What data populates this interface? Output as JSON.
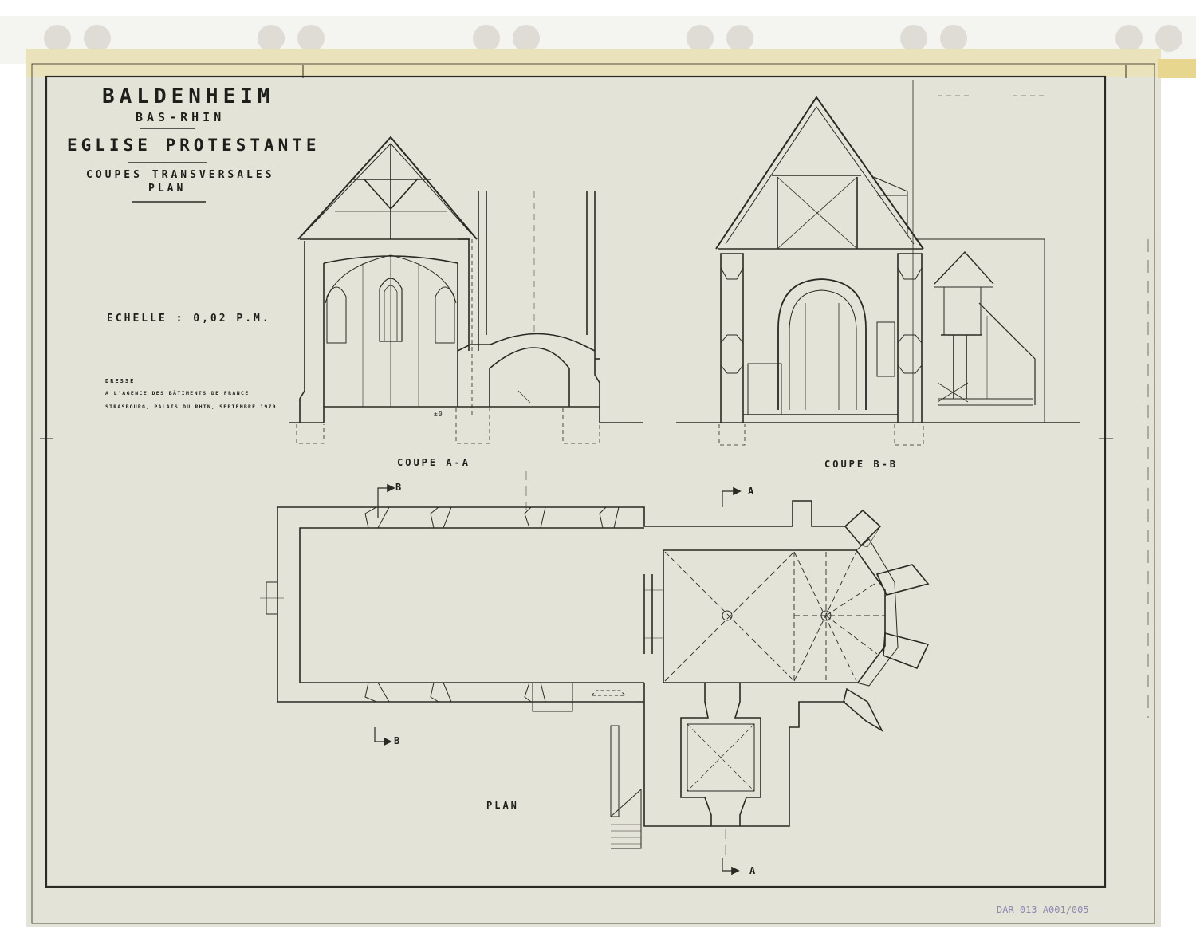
{
  "title_block": {
    "town": "BALDENHEIM",
    "department": "BAS-RHIN",
    "building": "EGLISE PROTESTANTE",
    "subject_line1": "COUPES TRANSVERSALES",
    "subject_line2": "PLAN"
  },
  "scale": "ECHELLE : 0,02 P.M.",
  "credits": {
    "line1": "DRESSÉ",
    "line2": "A L'AGENCE DES BÂTIMENTS DE FRANCE",
    "line3": "STRASBOURG, PALAIS DU RHIN, SEPTEMBRE 1979"
  },
  "views": {
    "section_aa": "COUPE A-A",
    "section_bb": "COUPE B-B",
    "plan": "PLAN"
  },
  "cut_markers": {
    "b_top": "B",
    "b_bottom": "B",
    "a_top": "A",
    "a_bottom": "A"
  },
  "level_mark": "±0",
  "archive_ref": "DAR 013 A001/005",
  "colors": {
    "paper": "#e4e3d8",
    "ink": "#2a2a24",
    "tape": "#ecdca0",
    "archive_ref": "#8e8ab0"
  }
}
